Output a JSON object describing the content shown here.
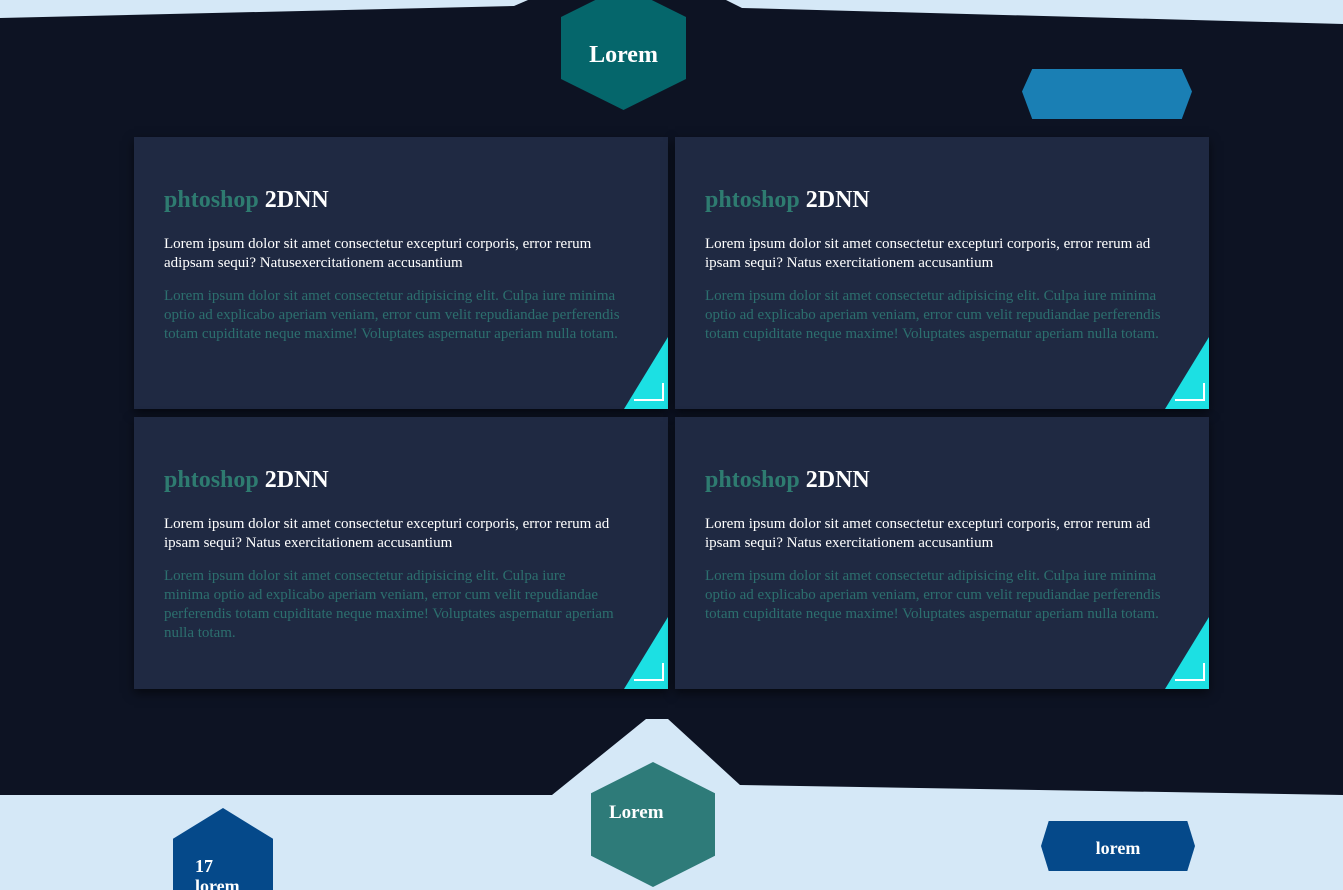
{
  "header": {
    "hex_title": "Lorem"
  },
  "cards": [
    {
      "brand": "phtoshop",
      "code": "2DNN",
      "lead": "Lorem ipsum dolor sit amet consectetur excepturi corporis, error rerum adipsam sequi? Natusexercitationem accusantium",
      "body": "Lorem ipsum dolor sit amet consectetur adipisicing elit. Culpa iure minima optio ad explicabo aperiam veniam, error cum velit repudiandae perferendis totam cupiditate neque maxime! Voluptates aspernatur aperiam nulla totam."
    },
    {
      "brand": "phtoshop",
      "code": "2DNN",
      "lead": "Lorem ipsum dolor sit amet consectetur excepturi corporis, error rerum ad ipsam sequi? Natus exercitationem accusantium",
      "body": "Lorem ipsum dolor sit amet consectetur adipisicing elit. Culpa iure minima optio ad explicabo aperiam veniam, error cum velit repudiandae perferendis totam cupiditate neque maxime! Voluptates aspernatur aperiam nulla totam."
    },
    {
      "brand": "phtoshop",
      "code": "2DNN",
      "lead": "Lorem ipsum dolor sit amet consectetur excepturi corporis, error rerum ad ipsam sequi? Natus exercitationem accusantium",
      "body": "Lorem ipsum dolor sit amet consectetur adipisicing elit. Culpa iure minima optio ad explicabo aperiam veniam, error cum velit repudiandae perferendis totam cupiditate neque maxime! Voluptates aspernatur aperiam nulla totam."
    },
    {
      "brand": "phtoshop",
      "code": "2DNN",
      "lead": "Lorem ipsum dolor sit amet consectetur excepturi corporis, error rerum ad ipsam sequi? Natus exercitationem accusantium",
      "body": "Lorem ipsum dolor sit amet consectetur adipisicing elit. Culpa iure minima optio ad explicabo aperiam veniam, error cum velit repudiandae perferendis totam cupiditate neque maxime! Voluptates aspernatur aperiam nulla totam."
    }
  ],
  "footer": {
    "hex_title": "Lorem",
    "date_text": "17 lorem",
    "button_label": "lorem"
  },
  "colors": {
    "dark_background": "#0d1323",
    "light_background": "#d5e8f7",
    "card_background": "#1f2942",
    "teal_hex": "#05666b",
    "accent_cyan": "#1ce0e3",
    "brand_text": "#2e7b70",
    "top_pill": "#1a7fb4",
    "navy": "#05498a"
  }
}
